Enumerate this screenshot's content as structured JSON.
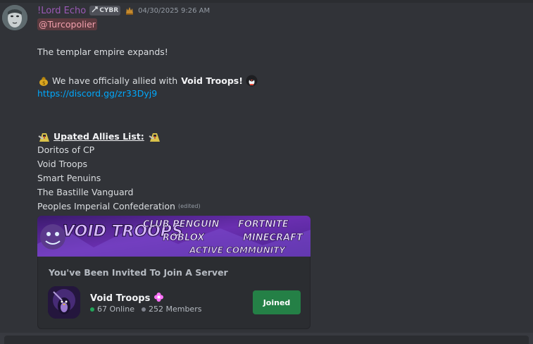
{
  "message": {
    "author": "!Lord Echo",
    "clan_tag": "CYBR",
    "timestamp": "04/30/2025 9:26 AM",
    "mention": "@Turcopolier",
    "line1": "The templar empire expands!",
    "allied_prefix": "We have officially allied with",
    "allied_name": "Void Troops!",
    "invite_link": "https://discord.gg/zr33Dyj9",
    "allies_heading": "Upated Allies List:",
    "allies": [
      "Doritos of CP",
      "Void Troops",
      "Smart Penuins",
      "The Bastille Vanguard",
      "Peoples Imperial Confederation"
    ],
    "edited_label": "(edited)"
  },
  "invite": {
    "banner_text": {
      "left": "VOID TROOPS",
      "r1a": "CLUB PENGUIN",
      "r1b": "FORTNITE",
      "r2a": "ROBLOX",
      "r2b": "MINECRAFT",
      "r3": "ACTIVE COMMUNITY"
    },
    "heading": "You've Been Invited To Join A Server",
    "server_name": "Void Troops",
    "online": "67 Online",
    "members": "252 Members",
    "button_label": "Joined"
  },
  "colors": {
    "username": "#9b59b6",
    "link": "#00a8fc",
    "button": "#248046",
    "online_dot": "#23a55a"
  }
}
